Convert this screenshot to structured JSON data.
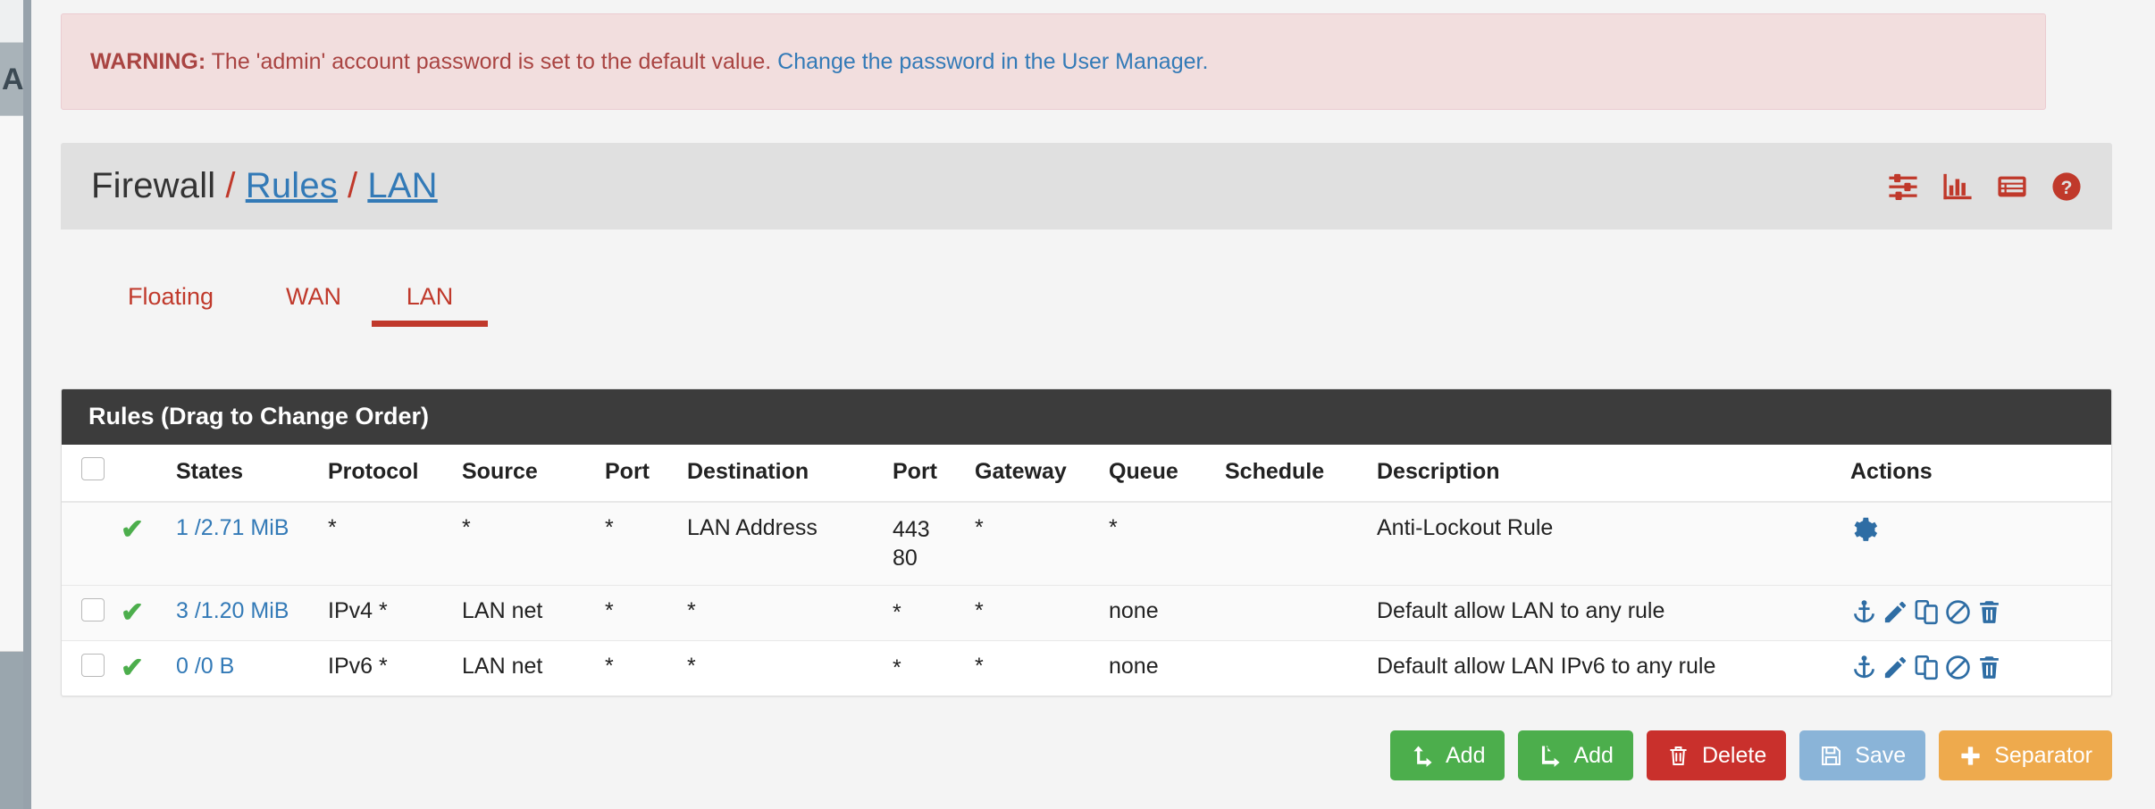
{
  "alert": {
    "prefix": "WARNING:",
    "message": "The 'admin' account password is set to the default value.",
    "link": "Change the password in the User Manager."
  },
  "breadcrumb": {
    "root": "Firewall",
    "sep": "/",
    "section": "Rules",
    "page": "LAN",
    "icons": [
      {
        "name": "sliders-icon",
        "title": "Advanced"
      },
      {
        "name": "chart-bar-icon",
        "title": "Statistics"
      },
      {
        "name": "list-icon",
        "title": "Log"
      },
      {
        "name": "help-circle-icon",
        "title": "Help"
      }
    ]
  },
  "tabs": [
    {
      "label": "Floating",
      "active": false
    },
    {
      "label": "WAN",
      "active": false
    },
    {
      "label": "LAN",
      "active": true
    }
  ],
  "panel": {
    "title": "Rules (Drag to Change Order)",
    "columns": [
      "",
      "",
      "States",
      "Protocol",
      "Source",
      "Port",
      "Destination",
      "Port",
      "Gateway",
      "Queue",
      "Schedule",
      "Description",
      "Actions"
    ],
    "headers": {
      "states": "States",
      "protocol": "Protocol",
      "source": "Source",
      "port_src": "Port",
      "destination": "Destination",
      "port_dst": "Port",
      "gateway": "Gateway",
      "queue": "Queue",
      "schedule": "Schedule",
      "description": "Description",
      "actions": "Actions"
    },
    "rows": [
      {
        "selectable": false,
        "status": "pass-check",
        "states": "1 /2.71 MiB",
        "protocol": "*",
        "source": "*",
        "port_src": "*",
        "destination": "LAN Address",
        "port_dst": [
          "443",
          "80"
        ],
        "gateway": "*",
        "queue": "*",
        "schedule": "",
        "description": "Anti-Lockout Rule",
        "actions": [
          "gear-icon"
        ]
      },
      {
        "selectable": true,
        "status": "pass-check",
        "states": "3 /1.20 MiB",
        "protocol": "IPv4 *",
        "source": "LAN net",
        "port_src": "*",
        "destination": "*",
        "port_dst": [
          "*"
        ],
        "gateway": "*",
        "queue": "none",
        "schedule": "",
        "description": "Default allow LAN to any rule",
        "actions": [
          "anchor-icon",
          "pencil-icon",
          "copy-icon",
          "ban-icon",
          "trash-icon"
        ]
      },
      {
        "selectable": true,
        "status": "pass-check",
        "states": "0 /0 B",
        "protocol": "IPv6 *",
        "source": "LAN net",
        "port_src": "*",
        "destination": "*",
        "port_dst": [
          "*"
        ],
        "gateway": "*",
        "queue": "none",
        "schedule": "",
        "description": "Default allow LAN IPv6 to any rule",
        "actions": [
          "anchor-icon",
          "pencil-icon",
          "copy-icon",
          "ban-icon",
          "trash-icon"
        ]
      }
    ]
  },
  "buttons": [
    {
      "label": "Add",
      "icon": "arrow-up-icon",
      "style": "success"
    },
    {
      "label": "Add",
      "icon": "arrow-down-icon",
      "style": "success"
    },
    {
      "label": "Delete",
      "icon": "trash-icon",
      "style": "danger"
    },
    {
      "label": "Save",
      "icon": "save-icon",
      "style": "info"
    },
    {
      "label": "Separator",
      "icon": "plus-icon",
      "style": "warning"
    }
  ],
  "colors": {
    "brand_red": "#c0392b",
    "link_blue": "#337ab7",
    "pass_green": "#4cae4c",
    "alert_bg": "#f2dede",
    "alert_text": "#a94442",
    "panel_head": "#3c3c3c"
  }
}
